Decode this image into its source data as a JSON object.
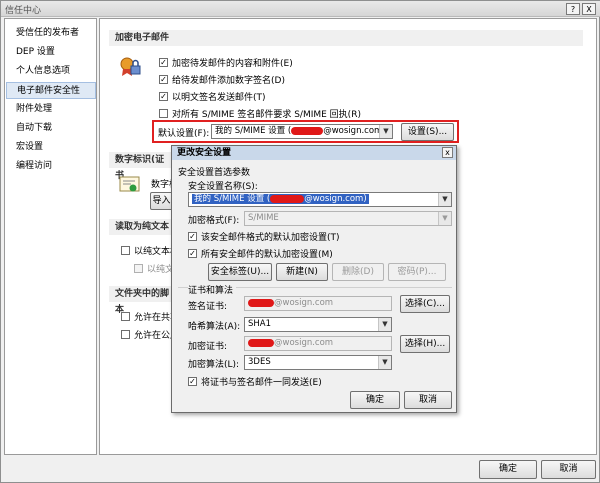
{
  "window": {
    "title": "信任中心",
    "help_btn": "?",
    "close_btn": "X"
  },
  "nav": {
    "items": [
      "受信任的发布者",
      "DEP 设置",
      "个人信息选项",
      "电子邮件安全性",
      "附件处理",
      "自动下载",
      "宏设置",
      "编程访问"
    ]
  },
  "encrypt": {
    "heading": "加密电子邮件",
    "opt1": "加密待发邮件的内容和附件(E)",
    "opt2": "给待发邮件添加数字签名(D)",
    "opt3": "以明文签名发送邮件(T)",
    "opt4": "对所有 S/MIME 签名邮件要求 S/MIME 回执(R)",
    "default_label": "默认设置(F):",
    "default_value_prefix": "我的 S/MIME 设置 (",
    "default_value_suffix": "@wosign.com)",
    "settings_btn": "设置(S)..."
  },
  "digital_id": {
    "heading": "数字标识(证书",
    "cert_label": "数字标",
    "import_btn": "导入"
  },
  "plaintext": {
    "heading": "读取为纯文本",
    "opt1": "以纯文本格",
    "opt2": "以纯文"
  },
  "folder": {
    "heading": "文件夹中的脚本",
    "opt1": "允许在共享",
    "opt2": "允许在公用"
  },
  "footer": {
    "ok": "确定",
    "cancel": "取消"
  },
  "dialog": {
    "title": "更改安全设置",
    "close_btn": "x",
    "group1": "安全设置首选参数",
    "name_label": "安全设置名称(S):",
    "name_prefix": "我的 S/MIME 设置 (",
    "name_suffix": "@wosign.com)",
    "format_label": "加密格式(F):",
    "format_value": "S/MIME",
    "cb1": "该安全邮件格式的默认加密设置(T)",
    "cb2": "所有安全邮件的默认加密设置(M)",
    "btn_labels": "安全标签(U)...",
    "btn_new": "新建(N)",
    "btn_delete": "删除(D)",
    "btn_password": "密码(P)...",
    "group2": "证书和算法",
    "sign_label": "签名证书:",
    "sign_value": "@wosign.com",
    "choose1": "选择(C)...",
    "hash_label": "哈希算法(A):",
    "hash_value": "SHA1",
    "enc_label": "加密证书:",
    "enc_value": "@wosign.com",
    "choose2": "选择(H)...",
    "encalg_label": "加密算法(L):",
    "encalg_value": "3DES",
    "send_cb": "将证书与签名邮件一同发送(E)",
    "ok": "确定",
    "cancel": "取消"
  },
  "colors": {
    "highlight_box": "#e02020",
    "redaction": "#e01818",
    "selection": "#3162c2"
  }
}
